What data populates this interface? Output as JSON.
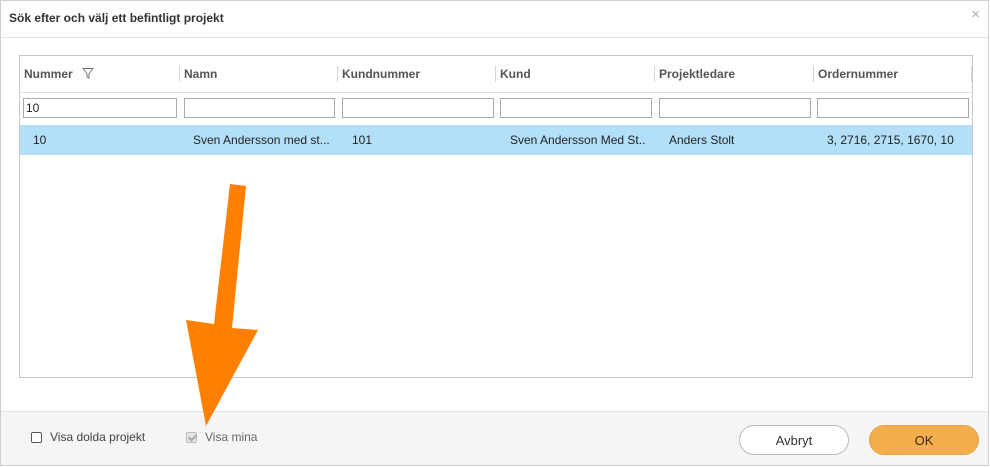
{
  "dialog": {
    "title": "Sök efter och välj ett befintligt projekt",
    "close_label": "×"
  },
  "grid": {
    "columns": [
      {
        "label": "Nummer",
        "filter_icon": "filter-icon"
      },
      {
        "label": "Namn"
      },
      {
        "label": "Kundnummer"
      },
      {
        "label": "Kund"
      },
      {
        "label": "Projektledare"
      },
      {
        "label": "Ordernummer"
      }
    ],
    "filters": [
      "10",
      "",
      "",
      "",
      "",
      ""
    ],
    "rows": [
      {
        "cells": [
          "10",
          "Sven Andersson med st...",
          "101",
          "Sven Andersson Med St...",
          "Anders Stolt",
          "3, 2716, 2715, 1670, 10"
        ],
        "selected": true,
        "highlight_color": "#b3e0f8"
      }
    ]
  },
  "footer": {
    "show_hidden_label": "Visa dolda projekt",
    "show_hidden_checked": false,
    "show_mine_label": "Visa mina",
    "show_mine_checked": true,
    "show_mine_disabled": true,
    "cancel_label": "Avbryt",
    "ok_label": "OK",
    "ok_color": "#f4ae4e"
  },
  "annotation": {
    "arrow_color": "#ff7f00",
    "arrow_icon": "arrow-down-icon"
  }
}
